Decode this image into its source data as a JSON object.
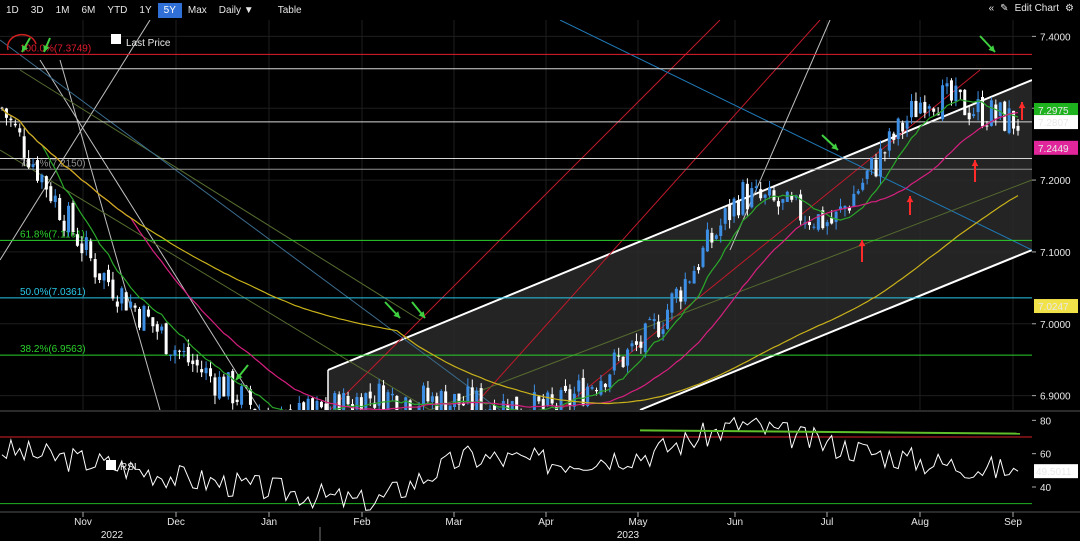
{
  "toolbar": {
    "ranges": [
      "1D",
      "3D",
      "1M",
      "6M",
      "YTD",
      "1Y",
      "5Y",
      "Max"
    ],
    "active_range": "5Y",
    "interval": "Daily",
    "table_label": "Table",
    "edit_chart": "Edit Chart",
    "collapse_icon": "double-chevron-left-icon",
    "edit_icon": "pencil-icon",
    "settings_icon": "gear-icon"
  },
  "legend": {
    "last_price": "Last Price",
    "rsi": "RSI"
  },
  "colors": {
    "up_candle": "#3d8fe6",
    "down_candle": "#ffffff",
    "fib_red": "#e21b2c",
    "fib_green": "#2bd12b",
    "fib_cyan": "#28c8e8",
    "ma_green": "#2aa82a",
    "ma_magenta": "#d6207f",
    "ma_yellow": "#c9b21a",
    "channel": "#ffffff",
    "rsi_line": "#ffffff"
  },
  "chart_data": [
    {
      "type": "line",
      "title": "",
      "series": [
        {
          "name": "Last Price",
          "x": [
            "2022-10",
            "2022-11",
            "2022-12",
            "2023-01",
            "2023-02",
            "2023-03",
            "2023-04",
            "2023-05",
            "2023-06",
            "2023-07",
            "2023-08",
            "2023-09"
          ],
          "values": [
            7.3,
            7.08,
            6.95,
            6.86,
            6.9,
            6.89,
            6.88,
            6.98,
            7.18,
            7.14,
            7.32,
            7.28
          ]
        }
      ],
      "ylim": [
        6.88,
        7.42
      ],
      "y_ticks": [
        "6.9000",
        "7.0000",
        "7.1000",
        "7.2000",
        "7.3000",
        "7.4000"
      ],
      "x_ticks": [
        "Nov",
        "Dec",
        "Jan",
        "Feb",
        "Mar",
        "Apr",
        "May",
        "Jun",
        "Jul",
        "Aug",
        "Sep"
      ],
      "years": [
        "2022",
        "2023"
      ],
      "fib_levels": [
        {
          "label": "100.0%(7.3749)",
          "value": 7.3749,
          "color": "red"
        },
        {
          "label": "78.4%(7.2150)",
          "value": 7.215,
          "color": "gray"
        },
        {
          "label": "61.8%(7.1161)",
          "value": 7.1161,
          "color": "green"
        },
        {
          "label": "50.0%(7.0361)",
          "value": 7.0361,
          "color": "cyan"
        },
        {
          "label": "38.2%(6.9563)",
          "value": 6.9563,
          "color": "green"
        }
      ],
      "price_labels": [
        {
          "text": "7.2975",
          "value": 7.2975,
          "color": "#1fb21f"
        },
        {
          "text": "7.2807",
          "value": 7.2807,
          "color": "#ffffff"
        },
        {
          "text": "7.2449",
          "value": 7.2449,
          "color": "#e0269a"
        },
        {
          "text": "7.0247",
          "value": 7.0247,
          "color": "#f2e24a"
        }
      ]
    },
    {
      "type": "line",
      "title": "",
      "series": [
        {
          "name": "RSI",
          "values": [
            62,
            55,
            45,
            38,
            30,
            58,
            55,
            60,
            78,
            65,
            55,
            49.5011
          ]
        }
      ],
      "ylim": [
        25,
        85
      ],
      "y_ticks": [
        "40",
        "60",
        "80"
      ],
      "last_label": "49.5011",
      "levels": [
        70,
        30
      ]
    }
  ]
}
